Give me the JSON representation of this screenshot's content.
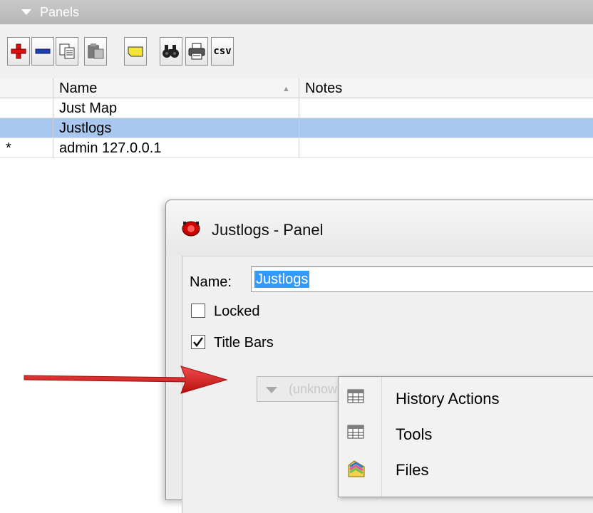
{
  "panels_header": {
    "title": "Panels"
  },
  "toolbar": {
    "buttons": [
      {
        "name": "add-button",
        "icon": "plus-icon"
      },
      {
        "name": "remove-button",
        "icon": "minus-icon"
      },
      {
        "name": "copy-button",
        "icon": "copy-icon"
      },
      {
        "name": "paste-button",
        "icon": "paste-icon"
      },
      {
        "name": "comment-button",
        "icon": "note-icon"
      },
      {
        "name": "find-button",
        "icon": "binoculars-icon"
      },
      {
        "name": "print-button",
        "icon": "printer-icon"
      },
      {
        "name": "csv-button",
        "icon": "csv-icon",
        "label": "csv"
      }
    ]
  },
  "table": {
    "columns": [
      "",
      "Name",
      "Notes"
    ],
    "rows": [
      {
        "marker": "",
        "name": "Just Map",
        "notes": "",
        "selected": false
      },
      {
        "marker": "",
        "name": "Justlogs",
        "notes": "",
        "selected": true
      },
      {
        "marker": "*",
        "name": "admin 127.0.0.1",
        "notes": "",
        "selected": false
      }
    ]
  },
  "dialog": {
    "title": "Justlogs - Panel",
    "name_label": "Name:",
    "name_value": "Justlogs",
    "locked_label": "Locked",
    "locked_checked": false,
    "titlebars_label": "Title Bars",
    "titlebars_checked": true,
    "dropdown_value": "(unknown)"
  },
  "menu": {
    "items": [
      {
        "label": "History Actions",
        "icon": "table-icon"
      },
      {
        "label": "Tools",
        "icon": "table-icon"
      },
      {
        "label": "Files",
        "icon": "files-icon"
      }
    ]
  },
  "colors": {
    "selection": "#a8c8ef",
    "input_selection": "#3399ff",
    "arrow": "#d71a1a"
  }
}
